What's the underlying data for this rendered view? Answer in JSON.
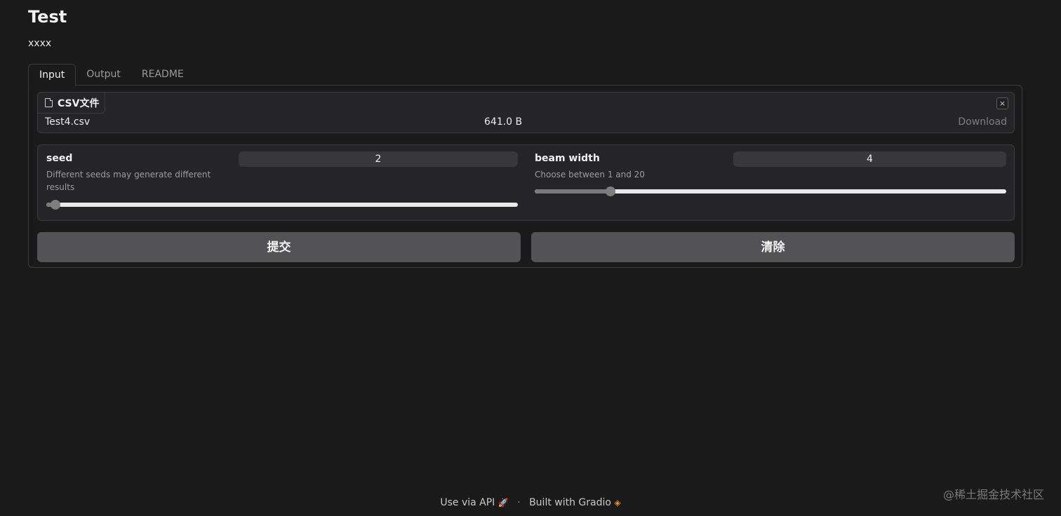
{
  "app": {
    "title": "Test",
    "description": "xxxx"
  },
  "tabs": [
    {
      "label": "Input",
      "active": true
    },
    {
      "label": "Output",
      "active": false
    },
    {
      "label": "README",
      "active": false
    }
  ],
  "file_input": {
    "label": "CSV文件",
    "file_name": "Test4.csv",
    "file_size": "641.0 B",
    "download_label": "Download",
    "close_symbol": "×"
  },
  "sliders": [
    {
      "label": "seed",
      "info": "Different seeds may generate different results",
      "value": "2",
      "min": 0,
      "max": 100,
      "level": 0.02
    },
    {
      "label": "beam width",
      "info": "Choose between 1 and 20",
      "value": "4",
      "min": 1,
      "max": 20,
      "level": 0.16
    }
  ],
  "buttons": {
    "submit": "提交",
    "clear": "清除"
  },
  "footer": {
    "api_link": "Use via API",
    "separator": "·",
    "built_with": "Built with Gradio",
    "rocket_icon": "rocket-icon",
    "gradio_icon": "gradio-logo-icon"
  },
  "watermark": "@稀土掘金技术社区",
  "colors": {
    "background": "#1a1a1b",
    "panel": "#252527",
    "button": "#535355",
    "accent": "#f08a24"
  }
}
